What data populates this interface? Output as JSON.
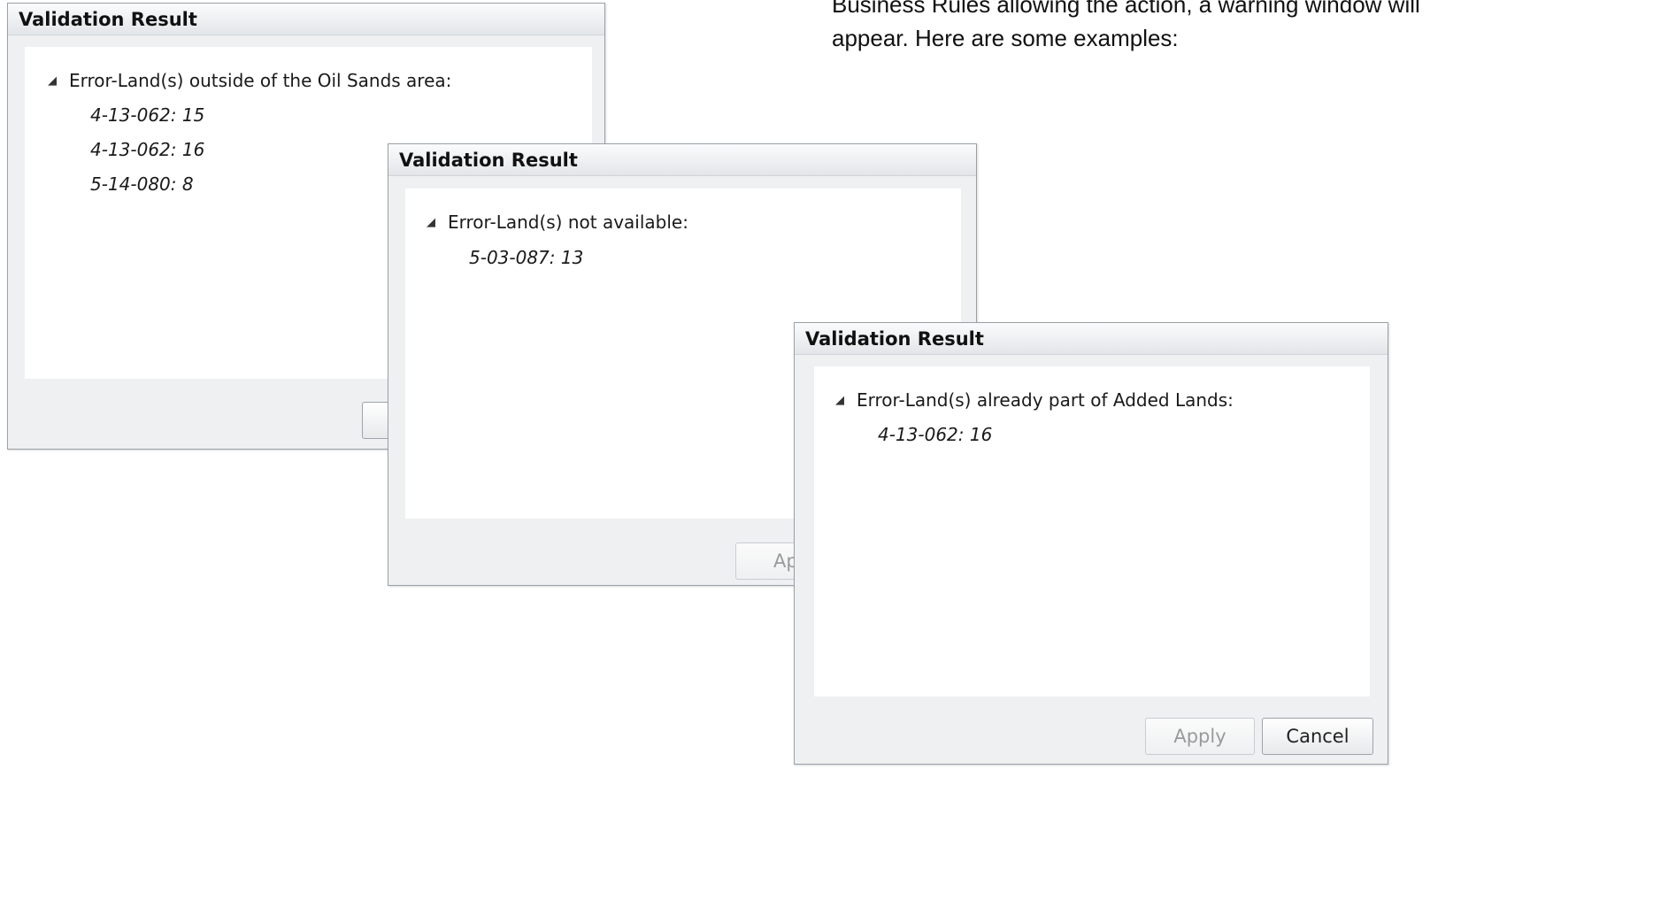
{
  "intro": {
    "line1": "Business Rules allowing the action, a warning window will",
    "line2": "appear. Here are some examples:"
  },
  "dialogs": [
    {
      "title": "Validation Result",
      "group": "Error-Land(s) outside of the Oil Sands area:",
      "items": [
        "4-13-062: 15",
        "4-13-062: 16",
        "5-14-080: 8"
      ]
    },
    {
      "title": "Validation Result",
      "group": "Error-Land(s) not available:",
      "items": [
        "5-03-087: 13"
      ],
      "apply_partial": "Ap"
    },
    {
      "title": "Validation Result",
      "group": "Error-Land(s) already part of Added Lands:",
      "items": [
        "4-13-062: 16"
      ],
      "apply_label": "Apply",
      "cancel_label": "Cancel"
    }
  ],
  "icons": {
    "expand": "expanded-triangle-icon"
  }
}
